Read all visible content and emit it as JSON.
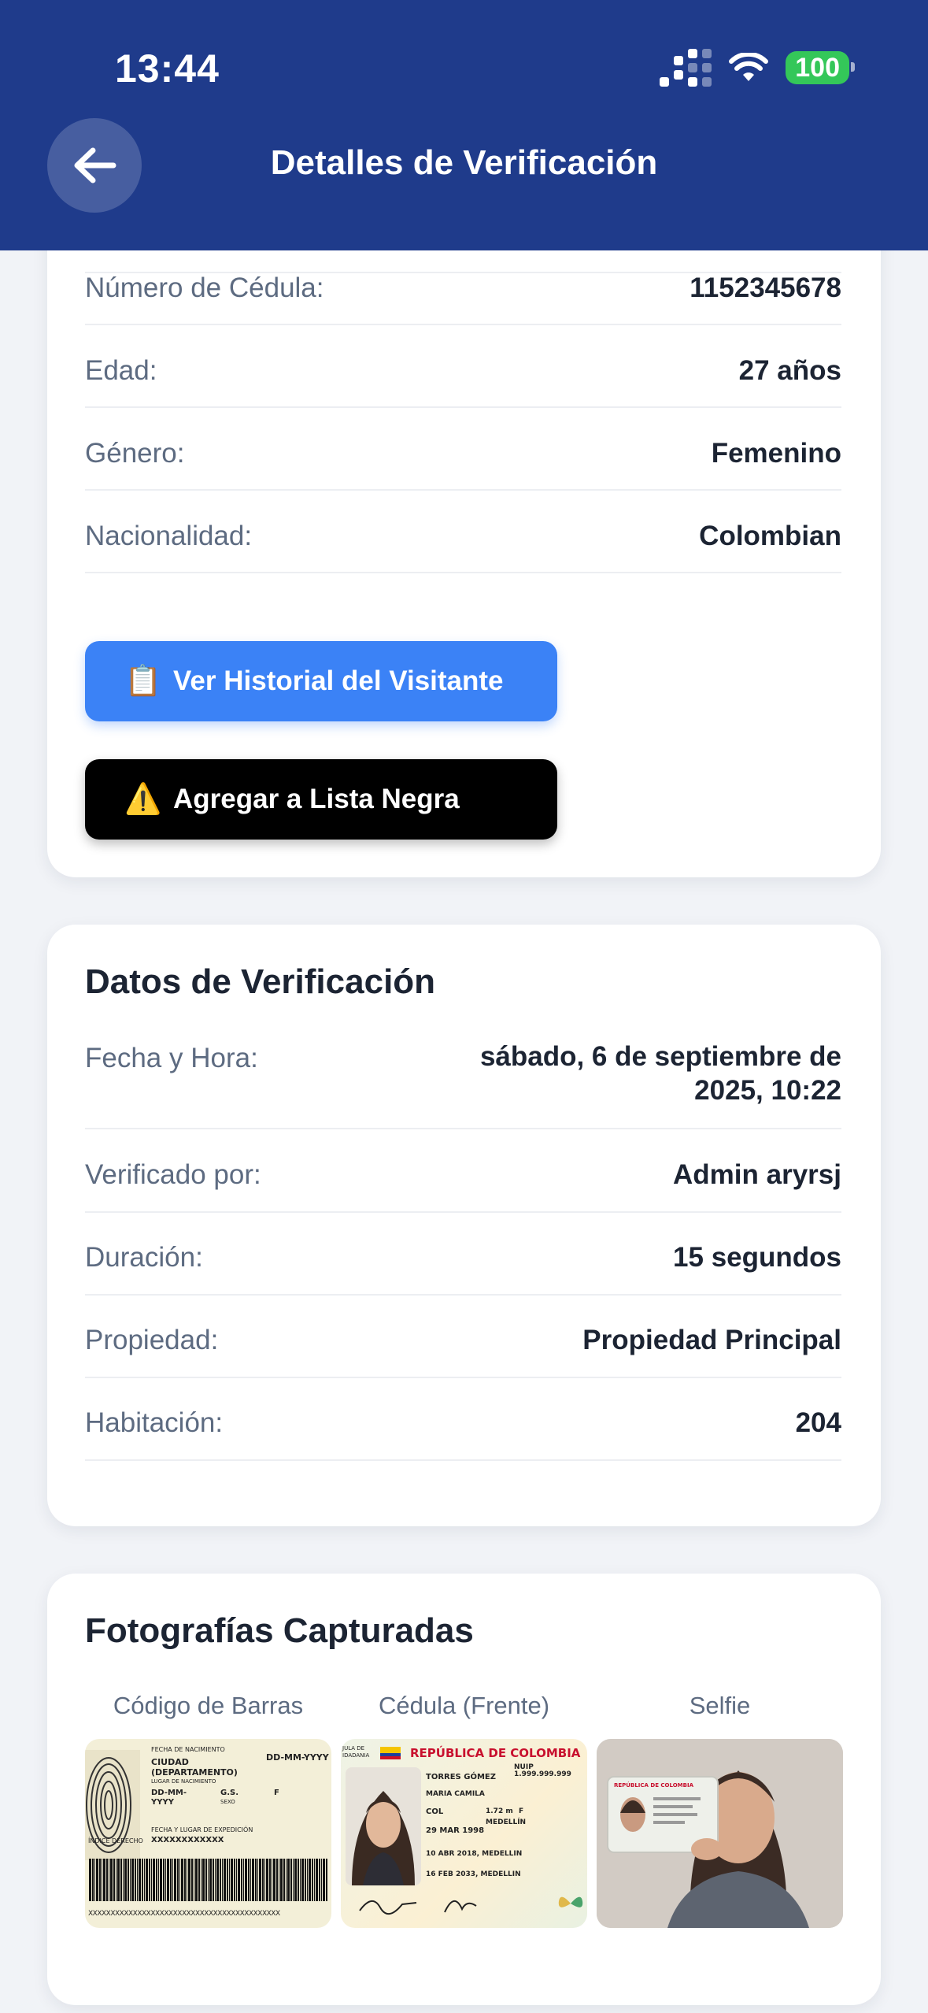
{
  "status_bar": {
    "time": "13:44",
    "battery": "100"
  },
  "header": {
    "title": "Detalles de Verificación"
  },
  "personal": {
    "rows": [
      {
        "label": "Número de Cédula:",
        "value": "1152345678"
      },
      {
        "label": "Edad:",
        "value": "27 años"
      },
      {
        "label": "Género:",
        "value": "Femenino"
      },
      {
        "label": "Nacionalidad:",
        "value": "Colombian"
      }
    ],
    "history_button": {
      "icon": "📋",
      "label": "Ver Historial del Visitante"
    },
    "blacklist_button": {
      "icon": "⚠️",
      "label": "Agregar a Lista Negra"
    }
  },
  "verification": {
    "title": "Datos de Verificación",
    "rows": [
      {
        "label": "Fecha y Hora:",
        "value": "sábado, 6 de septiembre de 2025, 10:22"
      },
      {
        "label": "Verificado por:",
        "value": "Admin aryrsj"
      },
      {
        "label": "Duración:",
        "value": "15 segundos"
      },
      {
        "label": "Propiedad:",
        "value": "Propiedad Principal"
      },
      {
        "label": "Habitación:",
        "value": "204"
      }
    ]
  },
  "photos": {
    "title": "Fotografías Capturadas",
    "items": [
      {
        "label": "Código de Barras"
      },
      {
        "label": "Cédula (Frente)"
      },
      {
        "label": "Selfie"
      }
    ],
    "barcode_card_text": {
      "birth_label": "FECHA DE NACIMIENTO",
      "birth_value": "DD-MM-YYYY",
      "city": "CIUDAD",
      "department": "(DEPARTAMENTO)",
      "birthplace_label": "LUGAR DE NACIMIENTO",
      "date_short": "DD-MM-",
      "year": "YYYY",
      "blood": "G.S.",
      "sex": "F",
      "sex_label": "SEXO",
      "expedition_label": "FECHA Y LUGAR DE EXPEDICIÓN",
      "expedition_value": "XXXXXXXXXXXX",
      "thumb_label": "ÍNDICE DERECHO",
      "mrz": "XXXXXXXXXXXXXXXXXXXXXXXXXXXXXXXXXXXXXXXXXXX"
    },
    "front_card_text": {
      "header_left": "JULA DE IDADANIA",
      "country": "REPÚBLICA DE COLOMBIA",
      "nuip": "NUIP 1.999.999.999",
      "surname": "TORRES GÓMEZ",
      "name": "MARIA CAMILA",
      "nationality": "COL",
      "height": "1.72 m",
      "sex": "F",
      "birth_date": "29 MAR 1998",
      "birth_place": "MEDELLÍN",
      "issue": "10 ABR 2018, MEDELLIN",
      "expiry": "16 FEB 2033, MEDELLIN"
    },
    "selfie_card_text": {
      "country": "REPÚBLICA DE COLOMBIA"
    }
  }
}
